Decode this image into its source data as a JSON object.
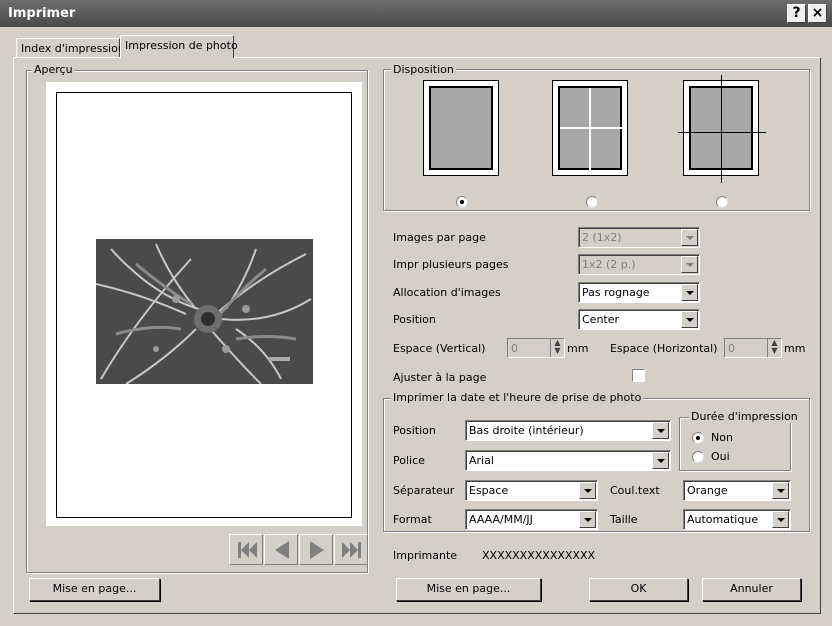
{
  "window": {
    "title": "Imprimer"
  },
  "title_buttons": {
    "help": "?",
    "close": "×"
  },
  "tabs": [
    {
      "label": "Index d'impression"
    },
    {
      "label": "Impression de photo"
    }
  ],
  "preview": {
    "label": "Aperçu",
    "nav": [
      "first-page-icon",
      "prev-page-icon",
      "next-page-icon",
      "last-page-icon"
    ],
    "setup_button": "Mise en page..."
  },
  "disposition": {
    "label": "Disposition",
    "selected_index": 0
  },
  "settings": {
    "images_per_page": {
      "label": "Images par page",
      "value": "2 (1x2)"
    },
    "multi_pages": {
      "label": "Impr plusieurs pages",
      "value": "1x2 (2 p.)"
    },
    "allocation": {
      "label": "Allocation d'images",
      "value": "Pas rognage"
    },
    "position": {
      "label": "Position",
      "value": "Center"
    },
    "space_vertical": {
      "label": "Espace (Vertical)",
      "value": "0",
      "unit": "mm"
    },
    "space_horizontal": {
      "label": "Espace (Horizontal)",
      "value": "0",
      "unit": "mm"
    },
    "fit_page": {
      "label": "Ajuster à la page"
    }
  },
  "date_print": {
    "label": "Imprimer la date et l'heure de prise de photo",
    "position": {
      "label": "Position",
      "value": "Bas droite (intérieur)"
    },
    "font": {
      "label": "Police",
      "value": "Arial"
    },
    "separator": {
      "label": "Séparateur",
      "value": "Espace"
    },
    "text_color": {
      "label": "Coul.text",
      "value": "Orange"
    },
    "format": {
      "label": "Format",
      "value": "AAAA/MM/JJ"
    },
    "size": {
      "label": "Taille",
      "value": "Automatique"
    },
    "duration": {
      "label": "Durée d'impression",
      "options": [
        "Non",
        "Oui"
      ],
      "selected": 0
    }
  },
  "printer": {
    "label": "Imprimante",
    "value": "XXXXXXXXXXXXXXX"
  },
  "buttons": {
    "page_setup": "Mise en page...",
    "ok": "OK",
    "cancel": "Annuler"
  },
  "colors": {
    "titlebar": "#5a5a5a",
    "face": "#d4d0c8"
  }
}
